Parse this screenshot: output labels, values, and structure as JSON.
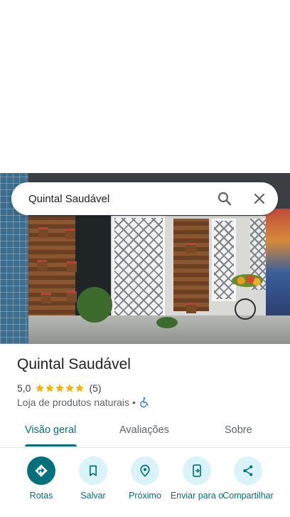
{
  "search": {
    "query": "Quintal Saudável"
  },
  "place": {
    "name": "Quintal Saudável",
    "rating": "5,0",
    "stars": 5,
    "reviews_count": "(5)",
    "category": "Loja de produtos naturais",
    "separator": "•"
  },
  "tabs": [
    {
      "label": "Visão geral"
    },
    {
      "label": "Avaliações"
    },
    {
      "label": "Sobre"
    }
  ],
  "actions": [
    {
      "label": "Rotas",
      "icon": "directions-icon"
    },
    {
      "label": "Salvar",
      "icon": "bookmark-icon"
    },
    {
      "label": "Próximo",
      "icon": "nearby-icon"
    },
    {
      "label": "Enviar para o",
      "icon": "send-to-phone-icon"
    },
    {
      "label": "Compartilhar",
      "icon": "share-icon"
    }
  ],
  "colors": {
    "accent": "#00707c",
    "accent_light": "#d9f3f8",
    "star": "#f4b400",
    "wheelchair": "#1a73e8"
  }
}
